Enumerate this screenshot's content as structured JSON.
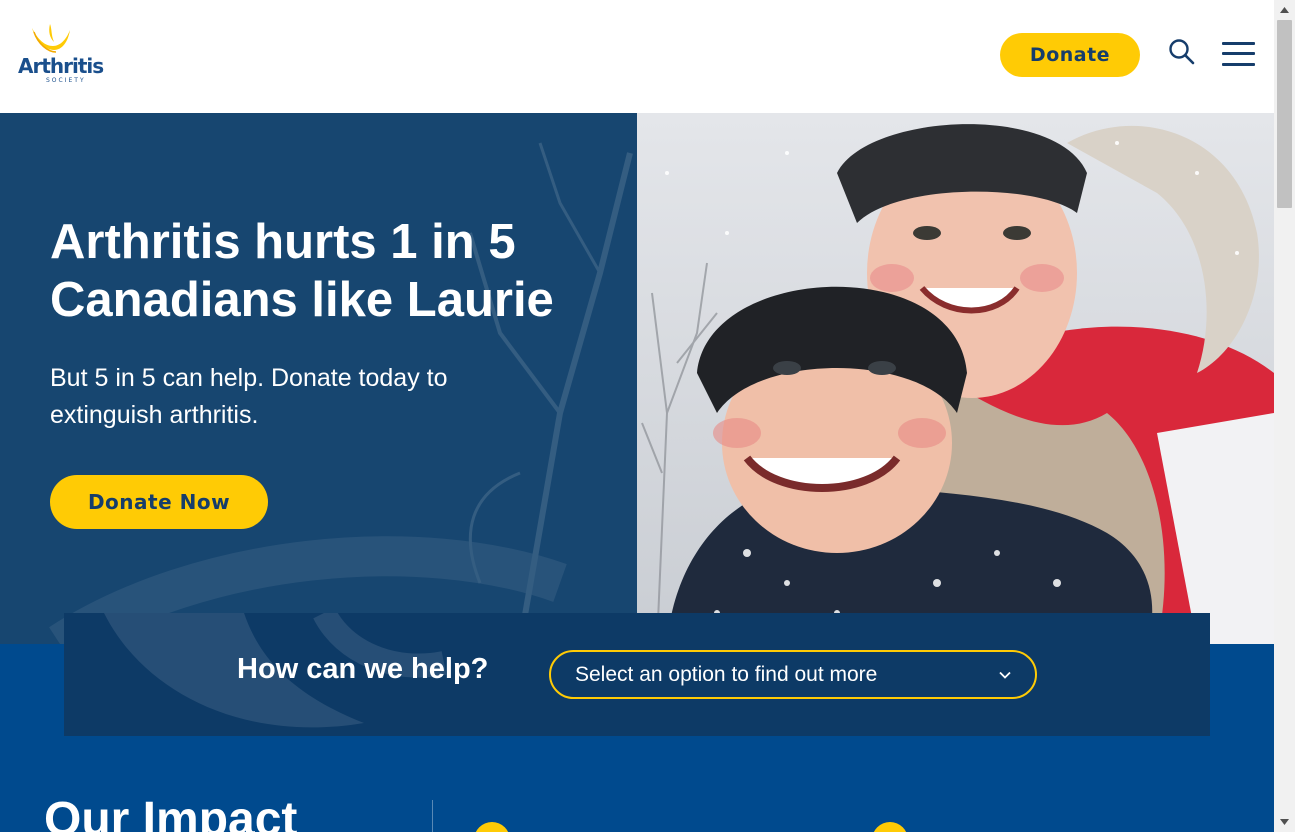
{
  "header": {
    "logo_text": "Arthritis",
    "logo_subtext": "SOCIETY",
    "donate_label": "Donate"
  },
  "hero": {
    "title": "Arthritis hurts 1 in 5 Canadians like Laurie",
    "subtitle": "But 5 in 5 can help. Donate today to extinguish arthritis.",
    "cta_label": "Donate Now"
  },
  "help": {
    "label": "How can we help?",
    "select_value": "Select an option to find out more"
  },
  "impact": {
    "title": "Our Impact"
  },
  "icons": {
    "search": "search-icon",
    "menu": "hamburger-menu-icon",
    "chevron": "chevron-down-icon"
  },
  "colors": {
    "brand_yellow": "#ffcb05",
    "hero_navy": "#174670",
    "band_blue": "#004a8e",
    "help_navy": "#0d3a66",
    "text_navy": "#163d6b"
  }
}
